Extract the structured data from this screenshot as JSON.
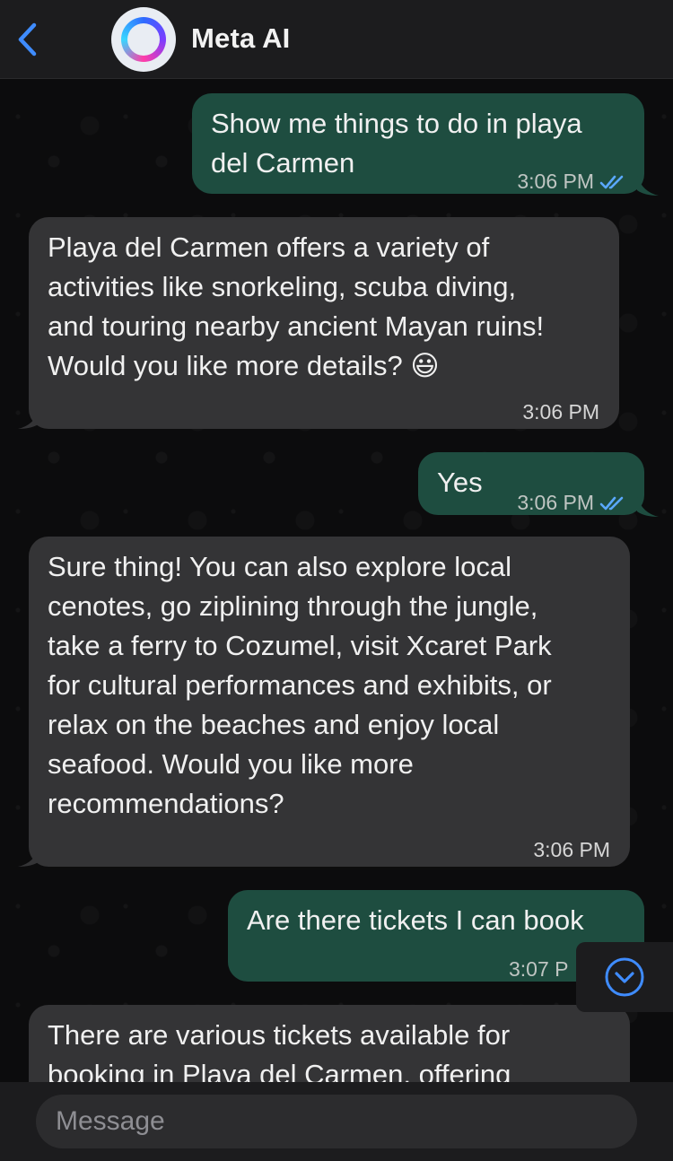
{
  "header": {
    "title": "Meta AI",
    "back_icon": "chevron-left-icon",
    "avatar_icon": "meta-ai-ring-icon"
  },
  "messages": [
    {
      "direction": "out",
      "text_lines": [
        "Show me things to do in playa",
        "del Carmen"
      ],
      "time": "3:06 PM",
      "read": true
    },
    {
      "direction": "in",
      "text_lines": [
        "Playa del Carmen offers a variety of",
        "activities like snorkeling, scuba diving,",
        "and touring nearby ancient Mayan ruins!",
        "Would you like more details? 😃"
      ],
      "time": "3:06 PM"
    },
    {
      "direction": "out",
      "text_lines": [
        "Yes"
      ],
      "time": "3:06 PM",
      "read": true
    },
    {
      "direction": "in",
      "text_lines": [
        "Sure thing! You can also explore local",
        "cenotes, go ziplining through the jungle,",
        "take a ferry to Cozumel, visit Xcaret Park",
        "for cultural performances and exhibits, or",
        "relax on the beaches and enjoy local",
        "seafood. Would you like more",
        "recommendations?"
      ],
      "time": "3:06 PM"
    },
    {
      "direction": "out",
      "text_lines": [
        "Are there tickets I can book"
      ],
      "time": "3:07 P"
    },
    {
      "direction": "in",
      "text_lines": [
        "There are various tickets available for",
        "booking in Playa del Carmen, offering"
      ]
    }
  ],
  "composer": {
    "placeholder": "Message"
  },
  "scroll_button": {
    "icon": "chevron-down-circle-icon"
  },
  "colors": {
    "outgoing_bubble": "#1e4d40",
    "incoming_bubble": "#343436",
    "read_ticks": "#5aa8ff",
    "accent": "#3f8cff"
  }
}
